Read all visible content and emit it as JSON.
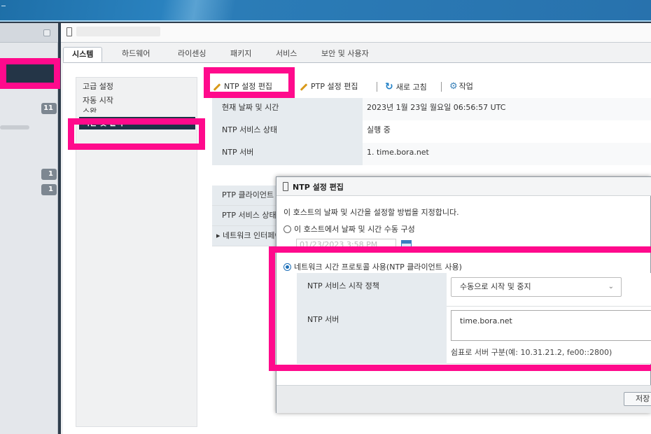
{
  "tabs": [
    {
      "label": "시스템",
      "active": true
    },
    {
      "label": "하드웨어"
    },
    {
      "label": "라이센싱"
    },
    {
      "label": "패키지"
    },
    {
      "label": "서비스"
    },
    {
      "label": "보안 및 사용자"
    }
  ],
  "nav": {
    "badges": [
      "11",
      "1",
      "1"
    ]
  },
  "subnav": {
    "items": [
      "고급 설정",
      "자동 시작",
      "스왑",
      "시간 및 날짜"
    ],
    "selected": "시간 및 날짜"
  },
  "toolbar": {
    "edit_ntp": "NTP 설정 편집",
    "edit_ptp": "PTP 설정 편집",
    "refresh": "새로 고침",
    "actions": "작업",
    "icons": [
      "pencil-icon",
      "refresh-icon",
      "gear-icon"
    ]
  },
  "info": {
    "rows": [
      {
        "label": "현재 날짜 및 시간",
        "value": "2023년 1월 23일 월요일 06:56:57 UTC"
      },
      {
        "label": "NTP 서비스 상태",
        "value": "실행 중"
      },
      {
        "label": "NTP 서버",
        "value": "1. time.bora.net"
      }
    ]
  },
  "ptp": {
    "rows": [
      "PTP 클라이언트",
      "PTP 서비스 상태",
      "▸ 네트워크 인터페이스"
    ]
  },
  "dialog": {
    "title": "NTP 설정 편집",
    "description": "이 호스트의 날짜 및 시간을 설정할 방법을 지정합니다.",
    "manual_option": "이 호스트에서 날짜 및 시간 수동 구성",
    "manual_date_value": "01/23/2023 3:58 PM",
    "ntp_option": "네트워크 시간 프로토콜 사용(NTP 클라이언트 사용)",
    "policy_label": "NTP 서비스 시작 정책",
    "policy_value": "수동으로 시작 및 중지",
    "server_label": "NTP 서버",
    "server_value": "time.bora.net",
    "server_hint": "쉼표로 서버 구분(예: 10.31.21.2, fe00::2800)",
    "save_label": "저장"
  },
  "colors": {
    "highlight": "#ff0a8c",
    "selected_nav": "#1f3347",
    "topbar": "#2872ad"
  }
}
